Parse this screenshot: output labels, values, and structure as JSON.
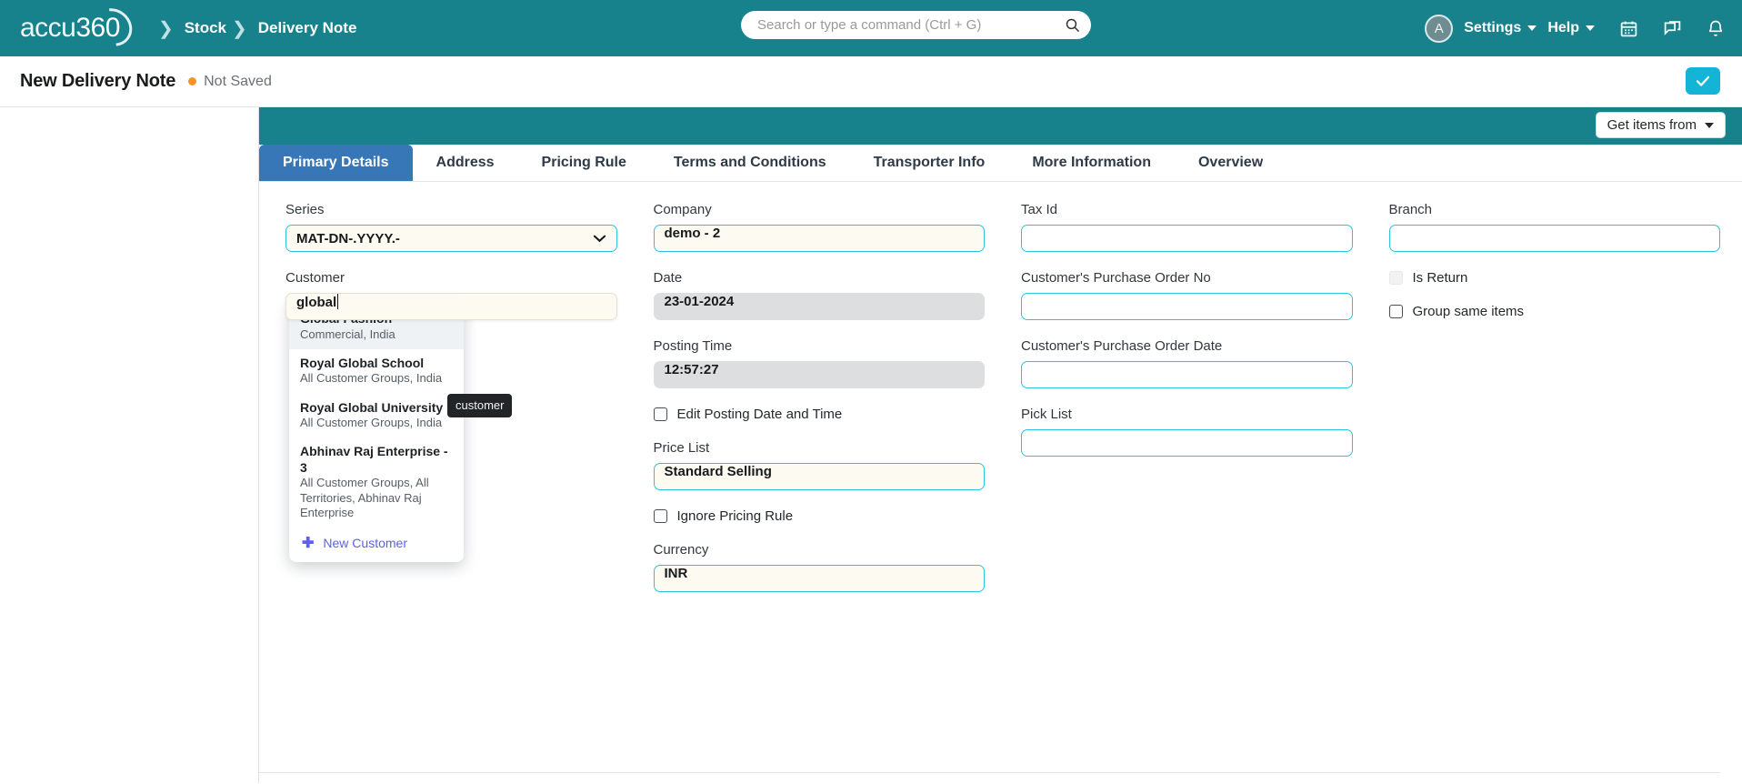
{
  "navbar": {
    "logo_accu": "accu",
    "logo_360": "360",
    "breadcrumb": [
      "Stock",
      "Delivery Note"
    ],
    "search_placeholder": "Search or type a command (Ctrl + G)",
    "search_value": "",
    "avatar_initial": "A",
    "settings_label": "Settings",
    "help_label": "Help",
    "icons": [
      "calendar-icon",
      "chat-icon",
      "bell-icon"
    ],
    "brand_color": "#17818c"
  },
  "page_head": {
    "title": "New Delivery Note",
    "status": "Not Saved",
    "status_color": "#f5922a",
    "save_button_color": "#14b4d6"
  },
  "toolbar": {
    "get_items_from": "Get items from"
  },
  "tabs": [
    {
      "label": "Primary Details",
      "active": true
    },
    {
      "label": "Address",
      "active": false
    },
    {
      "label": "Pricing Rule",
      "active": false
    },
    {
      "label": "Terms and Conditions",
      "active": false
    },
    {
      "label": "Transporter Info",
      "active": false
    },
    {
      "label": "More Information",
      "active": false
    },
    {
      "label": "Overview",
      "active": false
    }
  ],
  "form": {
    "col1": {
      "series_label": "Series",
      "series_value": "MAT-DN-.YYYY.-",
      "customer_label": "Customer",
      "customer_value": "global"
    },
    "col2": {
      "company_label": "Company",
      "company_value": "demo - 2",
      "date_label": "Date",
      "date_value": "23-01-2024",
      "posting_time_label": "Posting Time",
      "posting_time_value": "12:57:27",
      "edit_posting_label": "Edit Posting Date and Time",
      "price_list_label": "Price List",
      "price_list_value": "Standard Selling",
      "ignore_pricing_label": "Ignore Pricing Rule",
      "currency_label": "Currency",
      "currency_value": "INR"
    },
    "col3": {
      "tax_id_label": "Tax Id",
      "tax_id_value": "",
      "po_no_label": "Customer's Purchase Order No",
      "po_no_value": "",
      "po_date_label": "Customer's Purchase Order Date",
      "po_date_value": "",
      "pick_list_label": "Pick List",
      "pick_list_value": ""
    },
    "col4": {
      "branch_label": "Branch",
      "branch_value": "",
      "is_return_label": "Is Return",
      "group_same_items_label": "Group same items"
    }
  },
  "customer_dropdown": {
    "items": [
      {
        "title": "Global Fashion",
        "subtitle": "Commercial, India",
        "selected": true
      },
      {
        "title": "Royal Global School",
        "subtitle": "All Customer Groups, India",
        "selected": false
      },
      {
        "title": "Royal Global University",
        "subtitle": "All Customer Groups, India",
        "selected": false
      },
      {
        "title": "Abhinav Raj Enterprise - 3",
        "subtitle": "All Customer Groups, All Territories, Abhinav Raj Enterprise",
        "selected": false
      }
    ],
    "new_label": "New Customer",
    "new_color": "#5b61e8"
  },
  "tooltip": {
    "text": "customer"
  }
}
